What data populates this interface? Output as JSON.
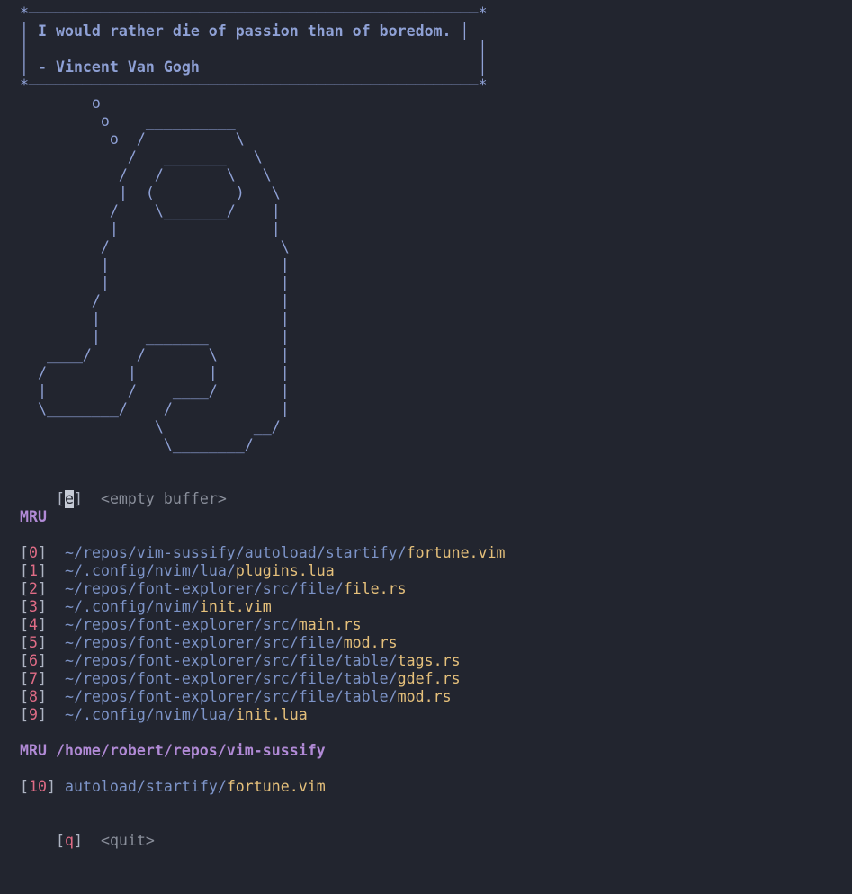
{
  "header": {
    "box_top": "*──────────────────────────────────────────────────*",
    "quote_line": "I would rather die of passion than of boredom.",
    "author_line": "- Vincent Van Gogh",
    "box_bottom": "*──────────────────────────────────────────────────*",
    "art": "        o\n         o    __________\n          o  /          \\\n            /   _______   \\\n           /   /       \\   \\\n           |  (         )   \\\n          /    \\_______/    |\n          |                 |\n         /                   \\\n         |                   |\n         |                   |\n        /                    |\n        |                    |\n        |     _______        |\n   ____/     /       \\       |\n  /         |        |       |\n  |         /    ____/       |\n  \\________/    /            |\n               \\          __/\n                \\________/"
  },
  "empty_buffer": {
    "open": "[",
    "key": "e",
    "close": "]",
    "label": "<empty buffer>"
  },
  "mru": {
    "title": "MRU",
    "items": [
      {
        "idx": "0",
        "path": "~/repos/vim-sussify/autoload/startify/",
        "file": "fortune.vim"
      },
      {
        "idx": "1",
        "path": "~/.config/nvim/lua/",
        "file": "plugins.lua"
      },
      {
        "idx": "2",
        "path": "~/repos/font-explorer/src/file/",
        "file": "file.rs"
      },
      {
        "idx": "3",
        "path": "~/.config/nvim/",
        "file": "init.vim"
      },
      {
        "idx": "4",
        "path": "~/repos/font-explorer/src/",
        "file": "main.rs"
      },
      {
        "idx": "5",
        "path": "~/repos/font-explorer/src/file/",
        "file": "mod.rs"
      },
      {
        "idx": "6",
        "path": "~/repos/font-explorer/src/file/table/",
        "file": "tags.rs"
      },
      {
        "idx": "7",
        "path": "~/repos/font-explorer/src/file/table/",
        "file": "gdef.rs"
      },
      {
        "idx": "8",
        "path": "~/repos/font-explorer/src/file/table/",
        "file": "mod.rs"
      },
      {
        "idx": "9",
        "path": "~/.config/nvim/lua/",
        "file": "init.lua"
      }
    ]
  },
  "mru_dir": {
    "title": "MRU /home/robert/repos/vim-sussify",
    "items": [
      {
        "idx": "10",
        "path": "autoload/startify/",
        "file": "fortune.vim"
      }
    ]
  },
  "quit": {
    "open": "[",
    "key": "q",
    "close": "]",
    "label": "<quit>"
  },
  "colors": {
    "background": "#22252f",
    "path": "#7d94c8",
    "file": "#e5c07b",
    "index": "#e06c86",
    "section": "#b18ad6"
  }
}
